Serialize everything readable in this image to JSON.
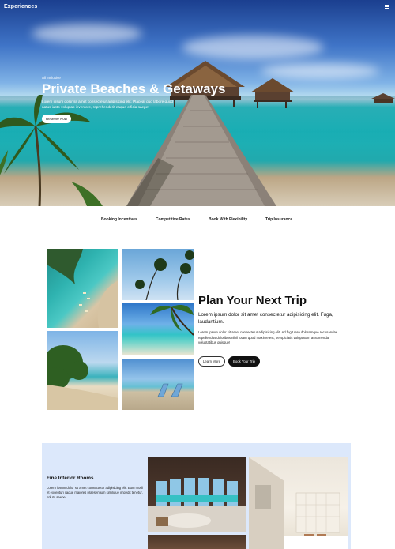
{
  "header": {
    "brand": "Experiences"
  },
  "hero": {
    "eyebrow": "All Inclusive",
    "title": "Private Beaches & Getaways",
    "description": "Lorem ipsum dolor sit amet consectetur adipisicing elit. Placeat quo labore quod natus iusto voluptas inventore, reprehenderit eaque officia saepe!",
    "cta_label": "Reserve Now"
  },
  "tabs": [
    {
      "label": "Booking Incentives"
    },
    {
      "label": "Competitive Rates"
    },
    {
      "label": "Book With Flexibility"
    },
    {
      "label": "Trip Insurance"
    }
  ],
  "plan": {
    "title": "Plan Your Next Trip",
    "lead": "Lorem ipsum dolor sit amet consectetur adipisicing elit. Fuga, laudantium.",
    "description": "Lorem ipsum dolor sit amet consectetur adipisicing elit. Ad fugit rero doloremque recusandae repellendus doloribus nihil totam quod maxime est, perspiciatis voluptatum assumenda, voluptatibus quisque!",
    "learn_more_label": "Learn More",
    "book_label": "Book Your Trip"
  },
  "interior": {
    "title": "Fine Interior Rooms",
    "description": "Lorem ipsum dolor sit amet consectetur adipisicing elit. Eum modi et excepturi itaque maiores praesentium similique impedit tenetur, soluta saepe."
  },
  "colors": {
    "interior_bg": "#dce8fb",
    "dark_button": "#111111",
    "hero_sky": "#3f74c7",
    "hero_sea": "#1ab3b8"
  }
}
